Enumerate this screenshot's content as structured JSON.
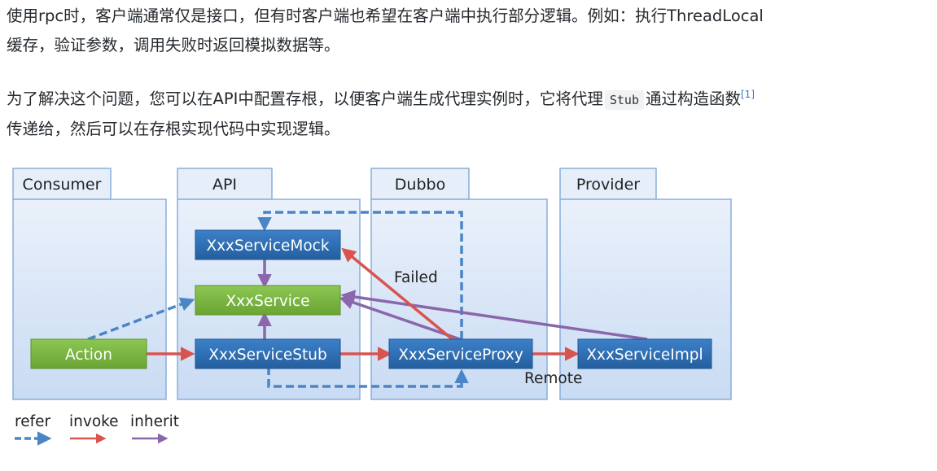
{
  "article": {
    "para1_line1": "使用rpc时，客户端通常仅是接口，但有时客户端也希望在客户端中执行部分逻辑。例如：执行ThreadLocal",
    "para1_line2": "缓存，验证参数，调用失败时返回模拟数据等。",
    "para2_line1_a": "为了解决这个问题，您可以在API中配置存根，以便客户端生成代理实例时，它将代理",
    "para2_code": "Stub",
    "para2_line1_b": "通过构造函数",
    "para2_footnote": "[1]",
    "para2_line2": "传递给，然后可以在存根实现代码中实现逻辑。"
  },
  "diagram": {
    "panels": {
      "consumer": "Consumer",
      "api": "API",
      "dubbo": "Dubbo",
      "provider": "Provider"
    },
    "boxes": {
      "action": "Action",
      "mock": "XxxServiceMock",
      "service": "XxxService",
      "stub": "XxxServiceStub",
      "proxy": "XxxServiceProxy",
      "impl": "XxxServiceImpl"
    },
    "labels": {
      "failed": "Failed",
      "remote": "Remote"
    },
    "legend": {
      "refer": "refer",
      "invoke": "invoke",
      "inherit": "inherit"
    },
    "colors": {
      "refer": "#4a86c5",
      "invoke": "#d9534f",
      "inherit": "#8a66aa",
      "blue_box": "#2f6fb4",
      "green_box": "#7cb642",
      "panel_fill": "#d9e6f7",
      "panel_stroke": "#8aaedb"
    }
  }
}
